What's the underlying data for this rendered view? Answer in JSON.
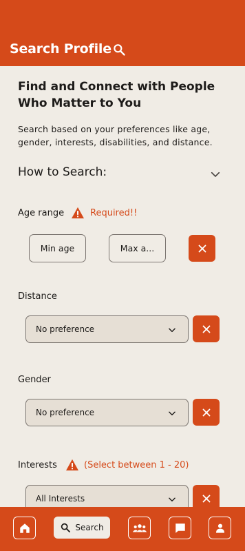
{
  "header": {
    "title": "Search Profile"
  },
  "page": {
    "title": "Find and Connect with People Who Matter to You",
    "description": "Search based on your preferences like age, gender, interests, disabilities, and distance.",
    "how_to_search": "How to Search:"
  },
  "age_range": {
    "label": "Age range",
    "warning": "Required!!",
    "min_placeholder": "Min age",
    "max_placeholder": "Max a..."
  },
  "distance": {
    "label": "Distance",
    "value": "No preference"
  },
  "gender": {
    "label": "Gender",
    "value": "No preference"
  },
  "interests": {
    "label": "Interests",
    "hint": "(Select between 1 - 20)",
    "value": "All Interests"
  },
  "bottom_nav": {
    "items": [
      {
        "name": "home",
        "icon": "home-icon"
      },
      {
        "name": "search",
        "icon": "search-icon",
        "label": "Search",
        "active": true
      },
      {
        "name": "groups",
        "icon": "groups-icon"
      },
      {
        "name": "messages",
        "icon": "chat-icon"
      },
      {
        "name": "profile",
        "icon": "person-icon"
      }
    ]
  },
  "colors": {
    "accent": "#d54a1a",
    "background": "#f0ece5",
    "field": "#e6dfd5"
  }
}
